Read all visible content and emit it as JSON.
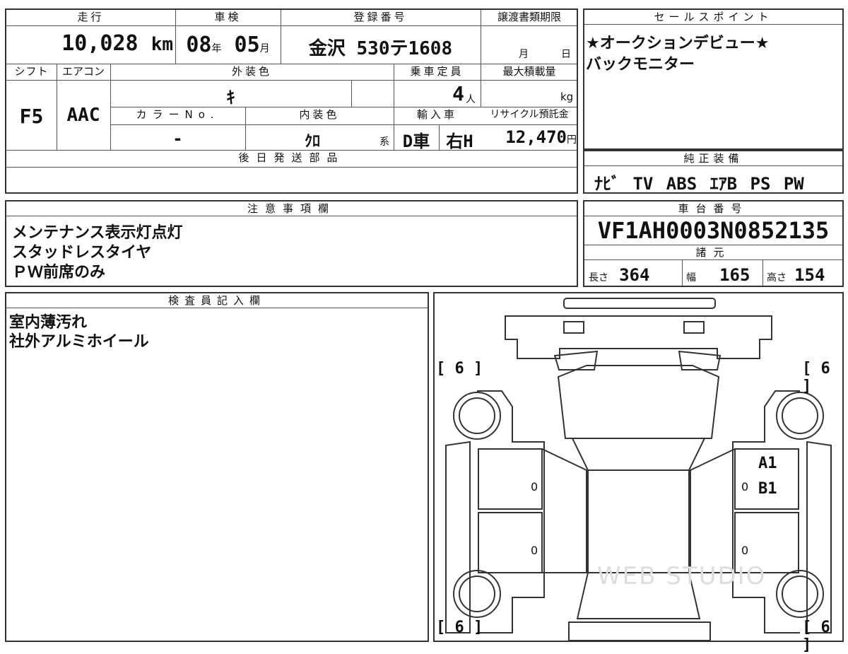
{
  "top_table": {
    "headers": {
      "mileage": "走行",
      "inspection": "車検",
      "registration": "登録番号",
      "transfer_deadline": "譲渡書類期限",
      "shift": "シフト",
      "aircon": "エアコン",
      "exterior_color": "外装色",
      "capacity": "乗車定員",
      "max_load": "最大積載量",
      "color_no": "カラーNo.",
      "interior_color": "内装色",
      "import": "輸入車",
      "recycle": "リサイクル預託金",
      "later_parts": "後日発送部品"
    },
    "mileage_value": "10,028",
    "mileage_unit": "km",
    "inspection_year": "08",
    "inspection_year_unit": "年",
    "inspection_month": "05",
    "inspection_month_unit": "月",
    "registration_value": "金沢 530テ1608",
    "transfer_month": "月",
    "transfer_day": "日",
    "shift_value": "F5",
    "aircon_value": "AAC",
    "exterior_color_value": "ｷ",
    "capacity_value": "4",
    "capacity_unit": "人",
    "max_load_unit": "kg",
    "color_no_value": "-",
    "interior_color_value": "ｸﾛ",
    "interior_color_unit": "系",
    "import_value_1": "D車",
    "import_value_2": "右H",
    "recycle_value": "12,470",
    "recycle_unit": "円"
  },
  "sales_points": {
    "header": "セールスポイント",
    "lines": [
      "★オークションデビュー★",
      "バックモニター"
    ]
  },
  "equipment": {
    "header": "純正装備",
    "value": "ﾅﾋﾞ TV ABS ｴｱB PS PW"
  },
  "notes": {
    "header": "注意事項欄",
    "lines": [
      "メンテナンス表示灯点灯",
      "スタッドレスタイヤ",
      "ＰＷ前席のみ"
    ]
  },
  "chassis": {
    "header": "車台番号",
    "value": "VF1AH0003N0852135",
    "spec_header": "諸元",
    "length_label": "長さ",
    "length_value": "364",
    "width_label": "幅",
    "width_value": "165",
    "height_label": "高さ",
    "height_value": "154"
  },
  "inspector": {
    "header": "検査員記入欄",
    "lines": [
      "室内薄汚れ",
      "社外アルミホイール"
    ]
  },
  "diagram": {
    "tire_fl": "[ 6 ]",
    "tire_fr": "[ 6 ]",
    "tire_rl": "[ 6 ]",
    "tire_rr": "[ 6 ]",
    "mark_a": "A1",
    "mark_b": "B1",
    "zero": "0",
    "watermark": "WEB STUDIO"
  }
}
